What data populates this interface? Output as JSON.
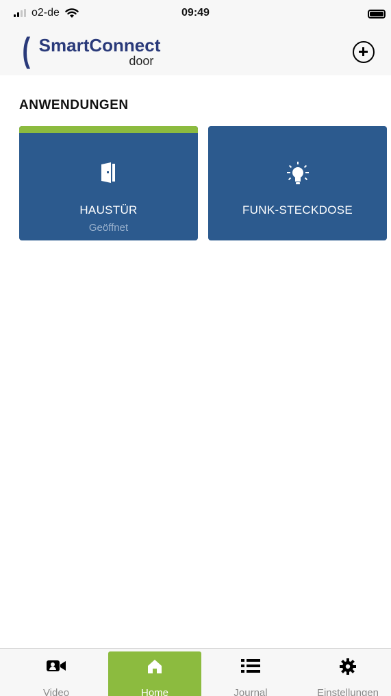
{
  "status_bar": {
    "carrier": "o2-de",
    "time": "09:49"
  },
  "header": {
    "logo_title": "SmartConnect",
    "logo_subtitle": "door",
    "add_icon": "plus-circle-icon"
  },
  "section": {
    "title": "ANWENDUNGEN"
  },
  "tiles": [
    {
      "label": "HAUSTÜR",
      "status": "Geöffnet",
      "icon": "door-icon",
      "accent": "#8cbb3f"
    },
    {
      "label": "FUNK-STECKDOSE",
      "status": "",
      "icon": "lightbulb-icon"
    }
  ],
  "tabs": [
    {
      "label": "Video",
      "icon": "video-camera-icon"
    },
    {
      "label": "Home",
      "icon": "home-icon",
      "active": true
    },
    {
      "label": "Journal",
      "icon": "list-icon"
    },
    {
      "label": "Einstellungen",
      "icon": "gear-icon"
    }
  ],
  "colors": {
    "tile_bg": "#2c5a8e",
    "accent_green": "#8cbb3f",
    "brand": "#2a3a7a"
  }
}
